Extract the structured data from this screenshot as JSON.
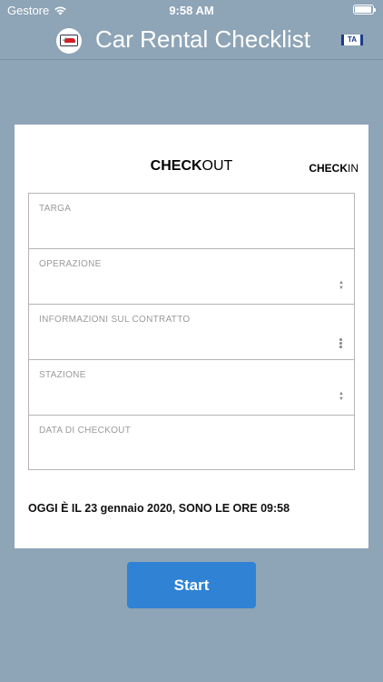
{
  "status_bar": {
    "carrier": "Gestore",
    "time": "9:58 AM"
  },
  "nav": {
    "title": "Car Rental Checklist",
    "language_flag": "TA"
  },
  "tabs": {
    "checkout": {
      "bold": "CHECK",
      "normal": "OUT"
    },
    "checkin": {
      "bold": "CHECK",
      "normal": "IN"
    }
  },
  "form": {
    "fields": [
      {
        "label": "TARGA",
        "value": "",
        "icon": ""
      },
      {
        "label": "OPERAZIONE",
        "value": "",
        "icon": "updown-chevron-icon"
      },
      {
        "label": "INFORMAZIONI SUL CONTRATTO",
        "value": "",
        "icon": "more-vertical-icon"
      },
      {
        "label": "STAZIONE",
        "value": "",
        "icon": "updown-chevron-icon"
      },
      {
        "label": "DATA DI CHECKOUT",
        "value": "",
        "icon": ""
      }
    ]
  },
  "date_line": "OGGI È IL 23 gennaio 2020, SONO LE ORE 09:58",
  "start_button": "Start",
  "colors": {
    "background": "#8ea4b7",
    "accent": "#2f82d4"
  }
}
